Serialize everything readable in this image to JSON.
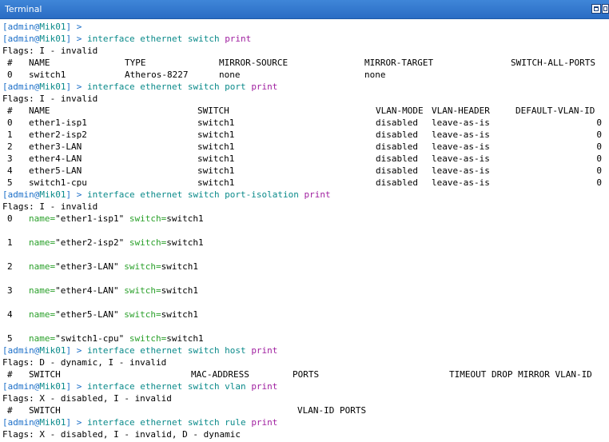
{
  "window": {
    "title": "Terminal",
    "icons": [
      "restore-icon",
      "close-icon"
    ]
  },
  "colors": {
    "titlebar": "#2a6cc4",
    "cmd": "#0a8a8a",
    "print": "#a020a0",
    "key": "#2aa02a",
    "bracket": "#1a6ec8"
  },
  "prompt": {
    "user": "admin",
    "at": "@",
    "host": "Mik01",
    "open": "[",
    "close": "] > "
  },
  "lines": {
    "l1": ">",
    "cmd1": "interface ethernet switch ",
    "cmd2": "interface ethernet switch port ",
    "cmd3": "interface ethernet switch port-isolation ",
    "cmd4": "interface ethernet switch host ",
    "cmd5": "interface ethernet switch vlan ",
    "cmd6": "interface ethernet switch rule ",
    "print": "print",
    "flags_i": "Flags: I - invalid",
    "flags_di": "Flags: D - dynamic, I - invalid",
    "flags_xi": "Flags: X - disabled, I - invalid",
    "flags_xid": "Flags: X - disabled, I - invalid, D - dynamic"
  },
  "switch_table": {
    "headers": [
      "#",
      "NAME",
      "TYPE",
      "MIRROR-SOURCE",
      "MIRROR-TARGET",
      "SWITCH-ALL-PORTS"
    ],
    "row": [
      "0",
      "switch1",
      "Atheros-8227",
      "none",
      "none",
      ""
    ]
  },
  "port_table": {
    "headers": [
      "#",
      "NAME",
      "SWITCH",
      "VLAN-MODE",
      "VLAN-HEADER",
      "DEFAULT-VLAN-ID"
    ],
    "rows": [
      [
        "0",
        "ether1-isp1",
        "switch1",
        "disabled",
        "leave-as-is",
        "0"
      ],
      [
        "1",
        "ether2-isp2",
        "switch1",
        "disabled",
        "leave-as-is",
        "0"
      ],
      [
        "2",
        "ether3-LAN",
        "switch1",
        "disabled",
        "leave-as-is",
        "0"
      ],
      [
        "3",
        "ether4-LAN",
        "switch1",
        "disabled",
        "leave-as-is",
        "0"
      ],
      [
        "4",
        "ether5-LAN",
        "switch1",
        "disabled",
        "leave-as-is",
        "0"
      ],
      [
        "5",
        "switch1-cpu",
        "switch1",
        "disabled",
        "leave-as-is",
        "0"
      ]
    ]
  },
  "isolation": {
    "name_key": "name=",
    "switch_key": "switch=",
    "rows": [
      {
        "n": "0",
        "name": "\"ether1-isp1\"",
        "switch": "switch1"
      },
      {
        "n": "1",
        "name": "\"ether2-isp2\"",
        "switch": "switch1"
      },
      {
        "n": "2",
        "name": "\"ether3-LAN\"",
        "switch": "switch1"
      },
      {
        "n": "3",
        "name": "\"ether4-LAN\"",
        "switch": "switch1"
      },
      {
        "n": "4",
        "name": "\"ether5-LAN\"",
        "switch": "switch1"
      },
      {
        "n": "5",
        "name": "\"switch1-cpu\"",
        "switch": "switch1"
      }
    ]
  },
  "host_table": {
    "headers": [
      "#",
      "SWITCH",
      "MAC-ADDRESS",
      "PORTS",
      "TIMEOUT DROP MIRROR VLAN-ID"
    ]
  },
  "vlan_table": {
    "headers": [
      "#",
      "SWITCH",
      "VLAN-ID PORTS"
    ]
  }
}
